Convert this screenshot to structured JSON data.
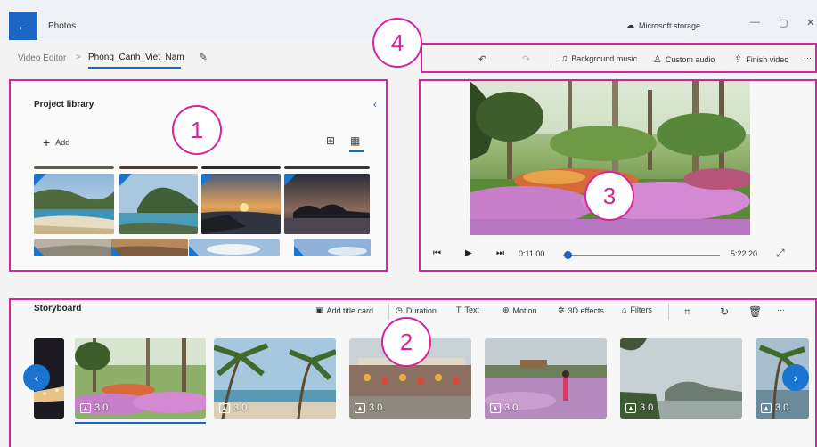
{
  "titlebar": {
    "app_title": "Photos",
    "storage_label": "Microsoft storage",
    "back_icon": "arrow-left-icon",
    "minimize": "—",
    "maximize": "▢",
    "close": "✕"
  },
  "breadcrumb": {
    "root": "Video Editor",
    "separator": ">",
    "project": "Phong_Canh_Viet_Nam"
  },
  "toolbar": {
    "background_music": "Background music",
    "custom_audio": "Custom audio",
    "finish_video": "Finish video",
    "more": "···"
  },
  "library": {
    "title": "Project library",
    "add_label": "Add"
  },
  "player": {
    "current_time": "0:11.00",
    "total_time": "5:22.20",
    "progress": 0.034
  },
  "storyboard": {
    "title": "Storyboard",
    "tools": {
      "add_title_card": "Add title card",
      "duration": "Duration",
      "text": "Text",
      "motion": "Motion",
      "effects_3d": "3D effects",
      "filters": "Filters",
      "more": "···"
    },
    "clips": [
      {
        "duration": "3.0"
      },
      {
        "duration": "3.0"
      },
      {
        "duration": "3.0"
      },
      {
        "duration": "3.0"
      },
      {
        "duration": "3.0"
      },
      {
        "duration": "3.0"
      }
    ]
  },
  "markers": [
    "1",
    "2",
    "3",
    "4"
  ],
  "colors": {
    "accent": "#1a66c2",
    "highlight": "#d6249f"
  }
}
